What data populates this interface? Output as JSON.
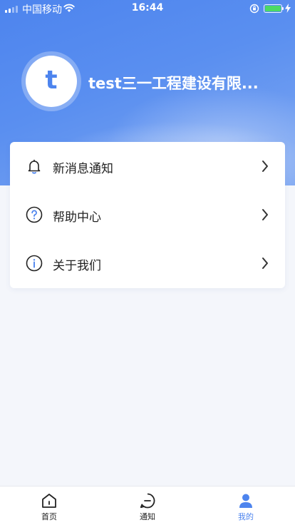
{
  "status_bar": {
    "carrier": "中国移动",
    "time": "16:44",
    "battery_color": "#4cd964"
  },
  "profile": {
    "avatar_letter": "t",
    "company_name": "test三一工程建设有限...",
    "accent_color": "#4d84ee"
  },
  "menu": {
    "items": [
      {
        "label": "新消息通知",
        "icon": "bell-icon"
      },
      {
        "label": "帮助中心",
        "icon": "help-circle-icon"
      },
      {
        "label": "关于我们",
        "icon": "info-circle-icon"
      }
    ]
  },
  "tabbar": {
    "tabs": [
      {
        "label": "首页",
        "icon": "home-icon",
        "active": false
      },
      {
        "label": "通知",
        "icon": "message-icon",
        "active": false
      },
      {
        "label": "我的",
        "icon": "user-icon",
        "active": true
      }
    ],
    "active_color": "#4d84ee"
  }
}
